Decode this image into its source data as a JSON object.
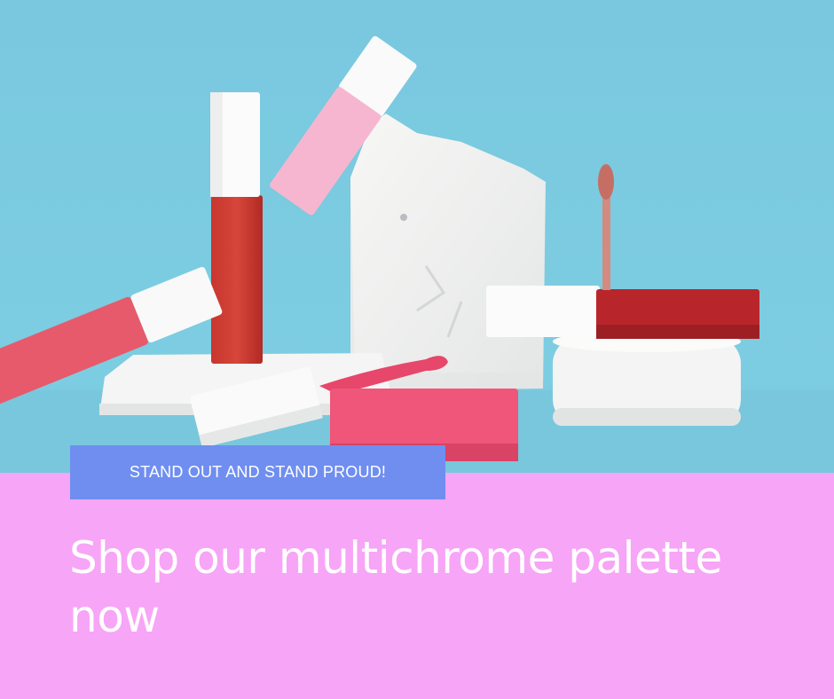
{
  "promo": {
    "tagline": "STAND OUT AND STAND PROUD!",
    "headline": "Shop our multichrome palette now"
  },
  "photo": {
    "subject": "lip-gloss-tubes-on-white-plaster-blocks"
  },
  "colors": {
    "background_blue": "#7ecbe0",
    "band_pink": "#f7a5f6",
    "tag_blue": "#6f8ef0",
    "text": "#ffffff"
  }
}
